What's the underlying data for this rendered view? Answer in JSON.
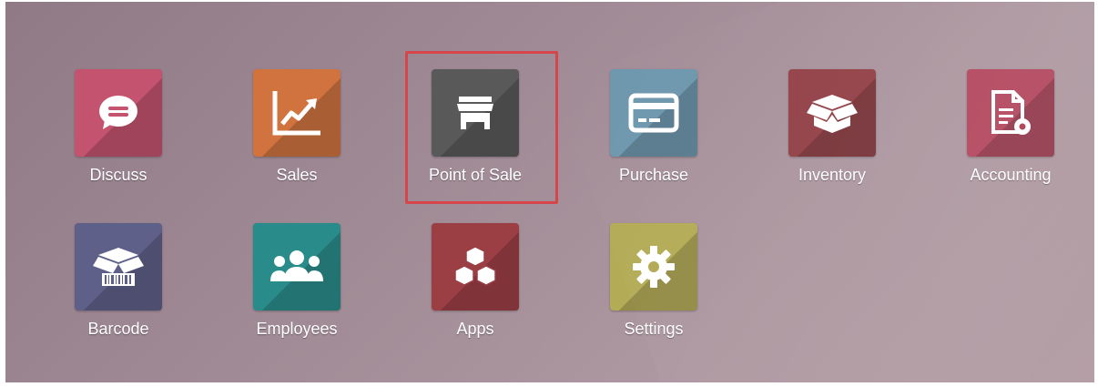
{
  "apps": [
    {
      "label": "Discuss",
      "color": "#c3536f",
      "icon": "chat-bubble-icon"
    },
    {
      "label": "Sales",
      "color": "#d0733f",
      "icon": "trend-chart-icon"
    },
    {
      "label": "Point of Sale",
      "color": "#595959",
      "icon": "store-icon"
    },
    {
      "label": "Purchase",
      "color": "#6e97ad",
      "icon": "credit-card-icon"
    },
    {
      "label": "Inventory",
      "color": "#934147",
      "icon": "open-box-icon"
    },
    {
      "label": "Accounting",
      "color": "#b3485f",
      "icon": "document-gear-icon"
    },
    {
      "label": "Barcode",
      "color": "#5f6089",
      "icon": "barcode-box-icon"
    },
    {
      "label": "Employees",
      "color": "#2a8c8a",
      "icon": "people-icon"
    },
    {
      "label": "Apps",
      "color": "#9c3f45",
      "icon": "cubes-icon"
    },
    {
      "label": "Settings",
      "color": "#b3ab56",
      "icon": "gear-icon"
    }
  ],
  "highlight": {
    "target": "Point of Sale",
    "color": "#d6454b"
  }
}
